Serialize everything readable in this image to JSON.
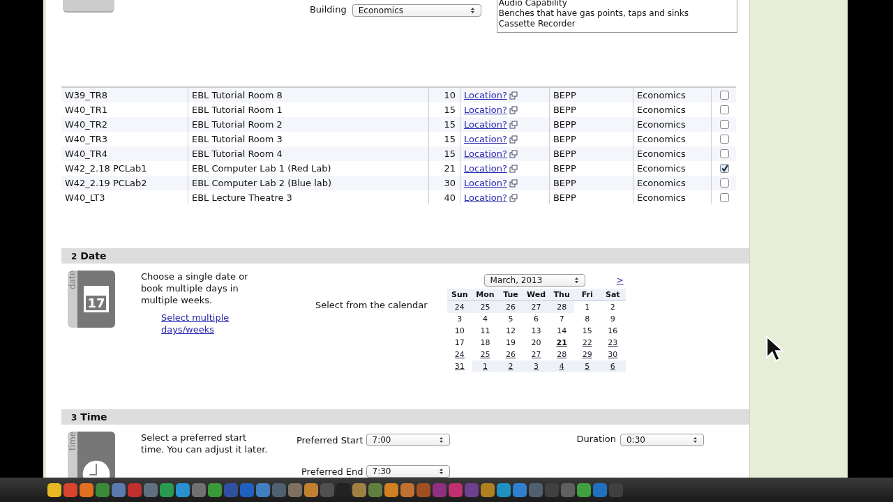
{
  "filters": {
    "building_label": "Building",
    "building_value": "Economics",
    "features": [
      "Audio Capability",
      "Benches that have gas points, taps and sinks",
      "Cassette Recorder"
    ]
  },
  "rooms": [
    {
      "code": "W39_TR8",
      "name": "EBL Tutorial Room 8",
      "capacity": "10",
      "location": "Location?",
      "department": "BEPP",
      "building": "Economics",
      "checked": false
    },
    {
      "code": "W40_TR1",
      "name": "EBL Tutorial Room 1",
      "capacity": "15",
      "location": "Location?",
      "department": "BEPP",
      "building": "Economics",
      "checked": false
    },
    {
      "code": "W40_TR2",
      "name": "EBL Tutorial Room 2",
      "capacity": "15",
      "location": "Location?",
      "department": "BEPP",
      "building": "Economics",
      "checked": false
    },
    {
      "code": "W40_TR3",
      "name": "EBL Tutorial Room 3",
      "capacity": "15",
      "location": "Location?",
      "department": "BEPP",
      "building": "Economics",
      "checked": false
    },
    {
      "code": "W40_TR4",
      "name": "EBL Tutorial Room 4",
      "capacity": "15",
      "location": "Location?",
      "department": "BEPP",
      "building": "Economics",
      "checked": false
    },
    {
      "code": "W42_2.18 PCLab1",
      "name": "EBL Computer Lab 1 (Red Lab)",
      "capacity": "21",
      "location": "Location?",
      "department": "BEPP",
      "building": "Economics",
      "checked": true
    },
    {
      "code": "W42_2.19 PCLab2",
      "name": "EBL Computer Lab 2 (Blue lab)",
      "capacity": "30",
      "location": "Location?",
      "department": "BEPP",
      "building": "Economics",
      "checked": false
    },
    {
      "code": "W40_LT3",
      "name": "EBL Lecture Theatre 3",
      "capacity": "40",
      "location": "Location?",
      "department": "BEPP",
      "building": "Economics",
      "checked": false
    }
  ],
  "date_section": {
    "number": "2",
    "title": "Date",
    "icon_label": "date",
    "icon_day": "17",
    "intro": "Choose a single date or book multiple days in multiple weeks.",
    "multi_link": "Select multiple days/weeks",
    "calendar_prompt": "Select from the calendar",
    "month": "March, 2013",
    "next": ">",
    "weekdays": [
      "Sun",
      "Mon",
      "Tue",
      "Wed",
      "Thu",
      "Fri",
      "Sat"
    ],
    "weeks": [
      [
        {
          "day": "24",
          "outside": true,
          "kind": "past"
        },
        {
          "day": "25",
          "outside": true,
          "kind": "past"
        },
        {
          "day": "26",
          "outside": true,
          "kind": "past"
        },
        {
          "day": "27",
          "outside": true,
          "kind": "past"
        },
        {
          "day": "28",
          "outside": true,
          "kind": "past"
        },
        {
          "day": "1",
          "outside": false,
          "kind": "past"
        },
        {
          "day": "2",
          "outside": false,
          "kind": "past"
        }
      ],
      [
        {
          "day": "3",
          "outside": false,
          "kind": "past"
        },
        {
          "day": "4",
          "outside": false,
          "kind": "past"
        },
        {
          "day": "5",
          "outside": false,
          "kind": "past"
        },
        {
          "day": "6",
          "outside": false,
          "kind": "past"
        },
        {
          "day": "7",
          "outside": false,
          "kind": "past"
        },
        {
          "day": "8",
          "outside": false,
          "kind": "past"
        },
        {
          "day": "9",
          "outside": false,
          "kind": "past"
        }
      ],
      [
        {
          "day": "10",
          "outside": false,
          "kind": "past"
        },
        {
          "day": "11",
          "outside": false,
          "kind": "past"
        },
        {
          "day": "12",
          "outside": false,
          "kind": "past"
        },
        {
          "day": "13",
          "outside": false,
          "kind": "past"
        },
        {
          "day": "14",
          "outside": false,
          "kind": "past"
        },
        {
          "day": "15",
          "outside": false,
          "kind": "past"
        },
        {
          "day": "16",
          "outside": false,
          "kind": "past"
        }
      ],
      [
        {
          "day": "17",
          "outside": false,
          "kind": "past"
        },
        {
          "day": "18",
          "outside": false,
          "kind": "past"
        },
        {
          "day": "19",
          "outside": false,
          "kind": "past"
        },
        {
          "day": "20",
          "outside": false,
          "kind": "past"
        },
        {
          "day": "21",
          "outside": false,
          "kind": "today"
        },
        {
          "day": "22",
          "outside": false,
          "kind": "bookable"
        },
        {
          "day": "23",
          "outside": false,
          "kind": "bookable"
        }
      ],
      [
        {
          "day": "24",
          "outside": false,
          "kind": "bookable"
        },
        {
          "day": "25",
          "outside": false,
          "kind": "bookable"
        },
        {
          "day": "26",
          "outside": false,
          "kind": "bookable"
        },
        {
          "day": "27",
          "outside": false,
          "kind": "bookable"
        },
        {
          "day": "28",
          "outside": false,
          "kind": "bookable"
        },
        {
          "day": "29",
          "outside": false,
          "kind": "bookable"
        },
        {
          "day": "30",
          "outside": false,
          "kind": "bookable"
        }
      ],
      [
        {
          "day": "31",
          "outside": false,
          "kind": "bookable"
        },
        {
          "day": "1",
          "outside": true,
          "kind": "bookable"
        },
        {
          "day": "2",
          "outside": true,
          "kind": "bookable"
        },
        {
          "day": "3",
          "outside": true,
          "kind": "bookable"
        },
        {
          "day": "4",
          "outside": true,
          "kind": "bookable"
        },
        {
          "day": "5",
          "outside": true,
          "kind": "bookable"
        },
        {
          "day": "6",
          "outside": true,
          "kind": "bookable"
        }
      ]
    ]
  },
  "time_section": {
    "number": "3",
    "title": "Time",
    "icon_label": "time",
    "intro": "Select a preferred start time. You can adjust it later.",
    "start_label": "Preferred Start",
    "start_value": "7:00",
    "end_label": "Preferred End",
    "end_value": "7:30",
    "duration_label": "Duration",
    "duration_value": "0:30"
  }
}
